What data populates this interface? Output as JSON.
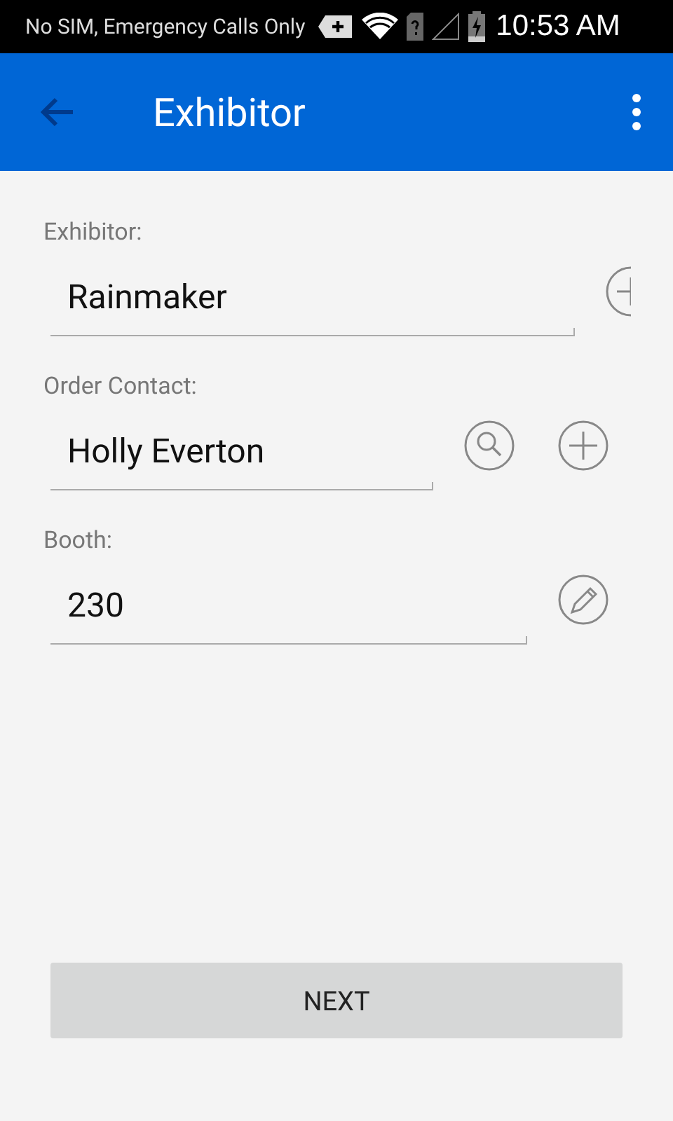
{
  "status_bar": {
    "carrier": "No SIM, Emergency Calls Only",
    "time": "10:53 AM"
  },
  "app_bar": {
    "title": "Exhibitor"
  },
  "fields": [
    {
      "label": "Exhibitor:",
      "value": "Rainmaker",
      "actions": [
        {
          "kind": "add",
          "clipped": true
        }
      ]
    },
    {
      "label": "Order Contact:",
      "value": "Holly Everton",
      "actions": [
        {
          "kind": "search",
          "clipped": false
        },
        {
          "kind": "add",
          "clipped": false
        }
      ]
    },
    {
      "label": "Booth:",
      "value": "230",
      "actions": [
        {
          "kind": "edit",
          "clipped": false
        }
      ]
    }
  ],
  "next_button": {
    "label": "NEXT"
  }
}
